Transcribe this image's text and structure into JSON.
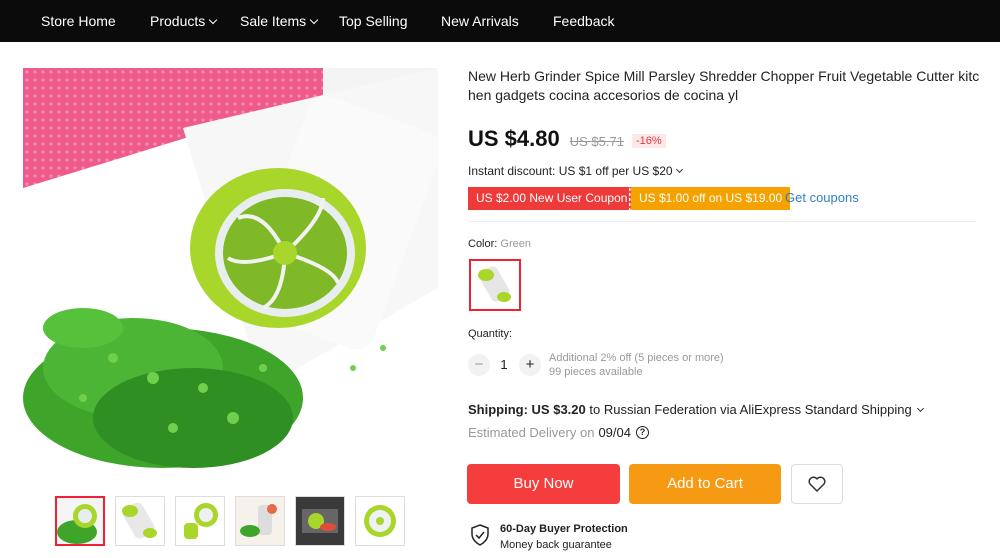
{
  "nav": {
    "items": [
      {
        "label": "Store Home",
        "dropdown": false
      },
      {
        "label": "Products",
        "dropdown": true
      },
      {
        "label": "Sale Items",
        "dropdown": true
      },
      {
        "label": "Top Selling",
        "dropdown": false
      },
      {
        "label": "New Arrivals",
        "dropdown": false
      },
      {
        "label": "Feedback",
        "dropdown": false
      }
    ]
  },
  "product": {
    "title": "New Herb Grinder Spice Mill Parsley Shredder Chopper Fruit Vegetable Cutter kitchen gadgets cocina accesorios de cocina yl",
    "price": "US $4.80",
    "old_price": "US $5.71",
    "discount": "-16%"
  },
  "promotions": {
    "instant_discount": "Instant discount: US $1 off per US $20",
    "coupons": [
      "US $2.00 New User Coupon",
      "US $1.00 off on US $19.00"
    ],
    "get_coupons": "Get coupons"
  },
  "color": {
    "label": "Color:",
    "value": "Green"
  },
  "quantity": {
    "label": "Quantity:",
    "value": "1",
    "minus": "−",
    "plus": "+",
    "additional": "Additional 2% off (5 pieces or more)",
    "available": "99 pieces available"
  },
  "shipping": {
    "label": "Shipping: US $3.20",
    "destination": "to Russian Federation via AliExpress Standard Shipping",
    "estimated_label": "Estimated Delivery on",
    "estimated_date": "09/04"
  },
  "actions": {
    "buy_now": "Buy Now",
    "add_to_cart": "Add to Cart"
  },
  "protection": {
    "title": "60-Day Buyer Protection",
    "subtitle": "Money back guarantee"
  },
  "colors": {
    "nav_bg": "#0b0b0b",
    "buy_now": "#f53d3d",
    "add_to_cart": "#f79a13",
    "coupon_red": "#ef3a3a",
    "coupon_orange": "#f5a200",
    "link": "#2f7fc7",
    "product_green": "#9fd12a"
  },
  "icons": [
    "chevron-down-icon",
    "help-circle-icon",
    "heart-icon",
    "shield-check-icon"
  ]
}
